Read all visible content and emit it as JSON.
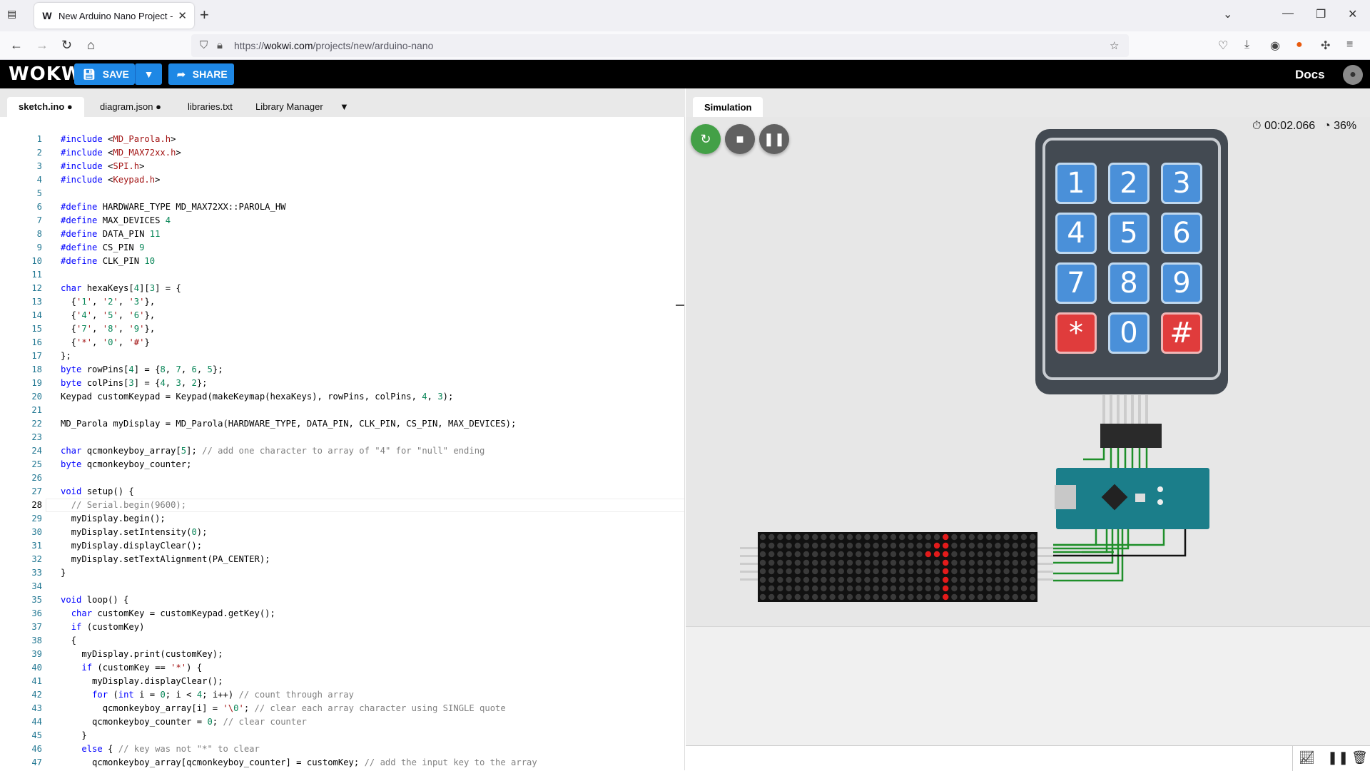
{
  "browser": {
    "tab_title": "New Arduino Nano Project - W",
    "url_scheme": "https://",
    "url_host": "wokwi.com",
    "url_path": "/projects/new/arduino-nano"
  },
  "header": {
    "logo": "WOKWi",
    "save_label": "SAVE",
    "share_label": "SHARE",
    "docs_label": "Docs"
  },
  "editor_tabs": [
    {
      "label": "sketch.ino"
    },
    {
      "label": "diagram.json"
    },
    {
      "label": "libraries.txt"
    },
    {
      "label": "Library Manager"
    }
  ],
  "code_lines": [
    "#include <MD_Parola.h>",
    "#include <MD_MAX72xx.h>",
    "#include <SPI.h>",
    "#include <Keypad.h>",
    "",
    "#define HARDWARE_TYPE MD_MAX72XX::PAROLA_HW",
    "#define MAX_DEVICES 4",
    "#define DATA_PIN 11",
    "#define CS_PIN 9",
    "#define CLK_PIN 10",
    "",
    "char hexaKeys[4][3] = {",
    "  {'1', '2', '3'},",
    "  {'4', '5', '6'},",
    "  {'7', '8', '9'},",
    "  {'*', '0', '#'}",
    "};",
    "byte rowPins[4] = {8, 7, 6, 5};",
    "byte colPins[3] = {4, 3, 2};",
    "Keypad customKeypad = Keypad(makeKeymap(hexaKeys), rowPins, colPins, 4, 3);",
    "",
    "MD_Parola myDisplay = MD_Parola(HARDWARE_TYPE, DATA_PIN, CLK_PIN, CS_PIN, MAX_DEVICES);",
    "",
    "char qcmonkeyboy_array[5]; // add one character to array of \"4\" for \"null\" ending",
    "byte qcmonkeyboy_counter;",
    "",
    "void setup() {",
    "  // Serial.begin(9600);",
    "  myDisplay.begin();",
    "  myDisplay.setIntensity(0);",
    "  myDisplay.displayClear();",
    "  myDisplay.setTextAlignment(PA_CENTER);",
    "}",
    "",
    "void loop() {",
    "  char customKey = customKeypad.getKey();",
    "  if (customKey)",
    "  {",
    "    myDisplay.print(customKey);",
    "    if (customKey == '*') {",
    "      myDisplay.displayClear();",
    "      for (int i = 0; i < 4; i++) // count through array",
    "        qcmonkeyboy_array[i] = '\\0'; // clear each array character using SINGLE quote",
    "      qcmonkeyboy_counter = 0; // clear counter",
    "    }",
    "    else { // key was not \"*\" to clear",
    "      qcmonkeyboy_array[qcmonkeyboy_counter] = customKey; // add the input key to the array"
  ],
  "current_line": 28,
  "simulation": {
    "tab_label": "Simulation",
    "timer": "00:02.066",
    "speed": "36%",
    "keypad_keys": [
      "1",
      "2",
      "3",
      "4",
      "5",
      "6",
      "7",
      "8",
      "9",
      "*",
      "0",
      "#"
    ]
  },
  "colors": {
    "accent": "#1e88e5",
    "restart": "#43a047",
    "stop": "#616161",
    "key_blue": "#4a90d9",
    "key_red": "#e03c3c"
  }
}
